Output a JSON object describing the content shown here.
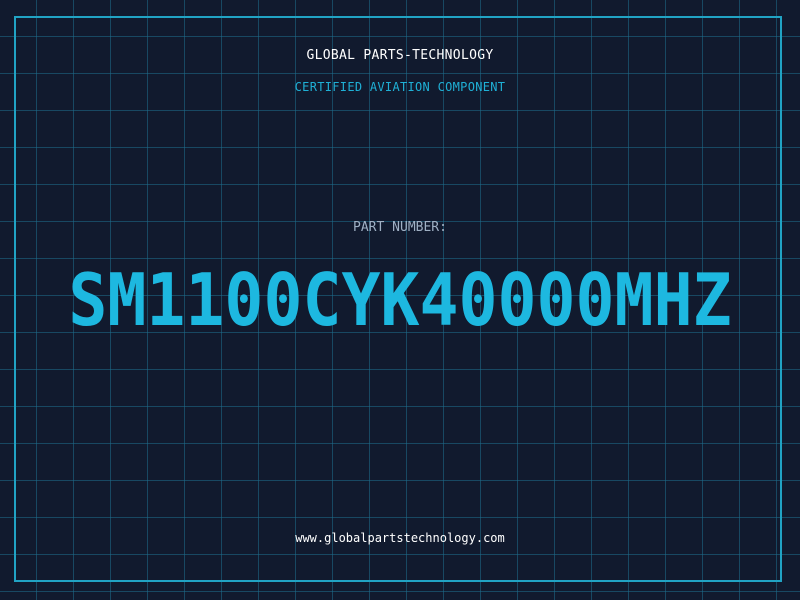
{
  "header": {
    "brand": "GLOBAL PARTS-TECHNOLOGY",
    "subtitle": "CERTIFIED AVIATION COMPONENT"
  },
  "part": {
    "label": "PART NUMBER:",
    "number": "SM1100CYK40000MHZ"
  },
  "footer": {
    "website": "www.globalpartstechnology.com"
  },
  "colors": {
    "background": "#111a2e",
    "grid": "#1e6e8c",
    "accent": "#1db8e0",
    "label": "#9fb0c4",
    "text": "#ffffff"
  }
}
